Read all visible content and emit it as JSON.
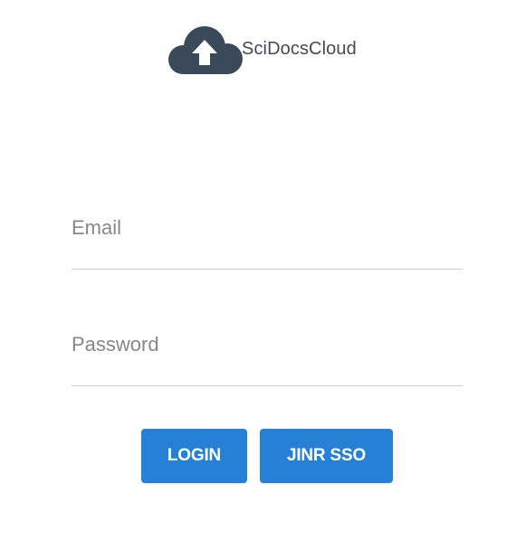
{
  "brand": {
    "name": "SciDocsCloud",
    "logo_icon": "cloud-upload-icon",
    "logo_color": "#3a4a5a"
  },
  "form": {
    "email_placeholder": "Email",
    "email_value": "",
    "password_placeholder": "Password",
    "password_value": ""
  },
  "buttons": {
    "login_label": "LOGIN",
    "sso_label": "JINR SSO",
    "color": "#2680d6"
  }
}
